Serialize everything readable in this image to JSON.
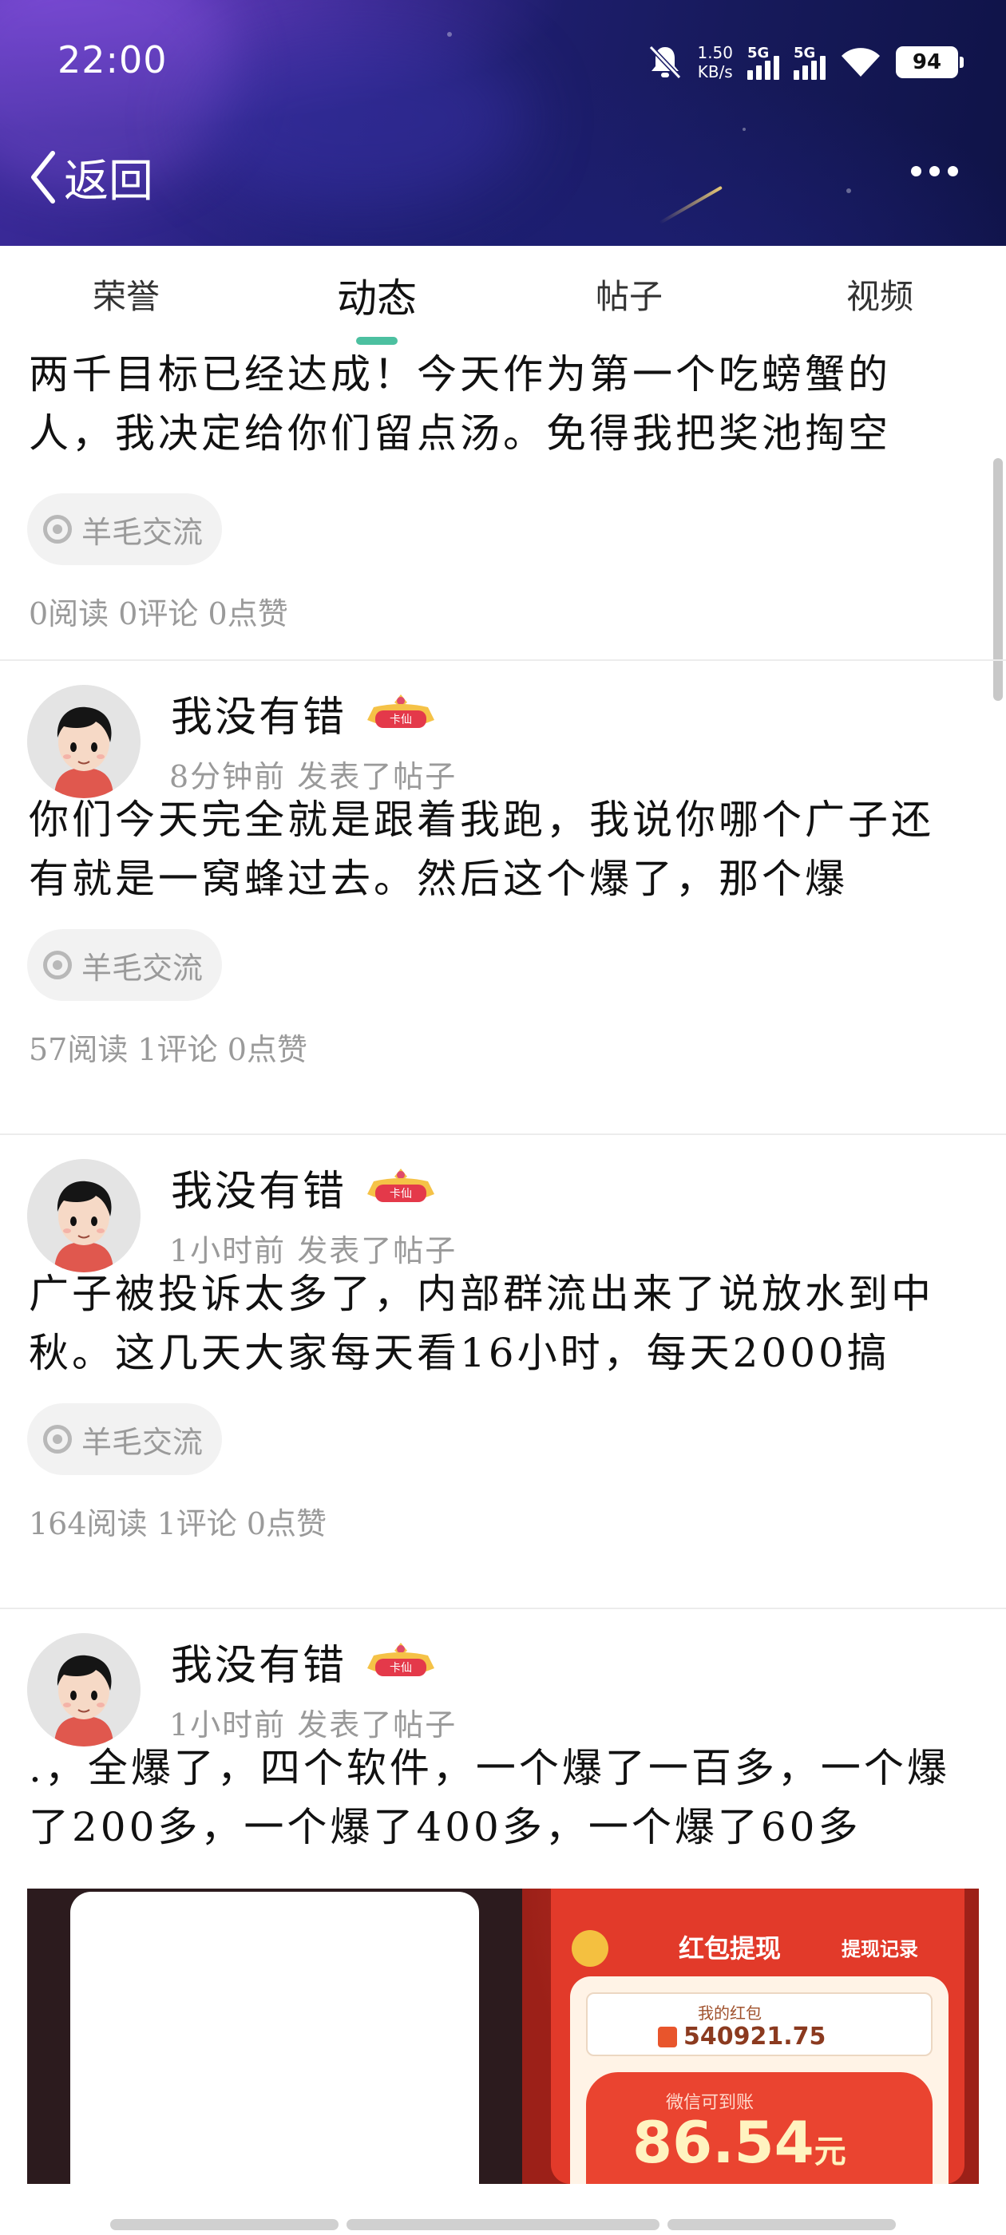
{
  "status_bar": {
    "time": "22:00",
    "net_speed_value": "1.50",
    "net_speed_unit": "KB/s",
    "signal1_label": "5G",
    "signal2_label": "5G",
    "battery": "94"
  },
  "nav": {
    "back_label": "返回"
  },
  "tabs": [
    {
      "label": "荣誉"
    },
    {
      "label": "动态"
    },
    {
      "label": "帖子"
    },
    {
      "label": "视频"
    }
  ],
  "active_tab_index": 1,
  "posts": [
    {
      "text_line1": "两千目标已经达成！今天作为第一个吃螃蟹的",
      "text_line2": "人，我决定给你们留点汤。免得我把奖池掏空",
      "tag": "羊毛交流",
      "stats": "0阅读 0评论 0点赞"
    },
    {
      "username": "我没有错",
      "badge": "卡仙",
      "meta": "8分钟前  发表了帖子",
      "text_line1": "你们今天完全就是跟着我跑，我说你哪个广子还",
      "text_line2": "有就是一窝蜂过去。然后这个爆了，那个爆",
      "tag": "羊毛交流",
      "stats": "57阅读 1评论 0点赞"
    },
    {
      "username": "我没有错",
      "badge": "卡仙",
      "meta": "1小时前  发表了帖子",
      "text_line1": "广子被投诉太多了，内部群流出来了说放水到中",
      "text_line2": "秋。这几天大家每天看16小时，每天2000搞",
      "tag": "羊毛交流",
      "stats": "164阅读 1评论 0点赞"
    },
    {
      "username": "我没有错",
      "badge": "卡仙",
      "meta": "1小时前  发表了帖子",
      "text_line1": ".，全爆了，四个软件，一个爆了一百多，一个爆",
      "text_line2": "了200多，一个爆了400多，一个爆了60多"
    }
  ],
  "attached_screenshot": {
    "title": "红包提现",
    "records_link": "提现记录",
    "my_redpacket_label": "我的红包",
    "my_redpacket_amount": "540921.75",
    "wechat_label": "微信可到账",
    "withdraw_amount": "86.54",
    "withdraw_unit": "元"
  },
  "colors": {
    "tab_indicator": "#4cc0a0",
    "header_dark": "#171a5c",
    "header_purple": "#6a3fc4"
  }
}
